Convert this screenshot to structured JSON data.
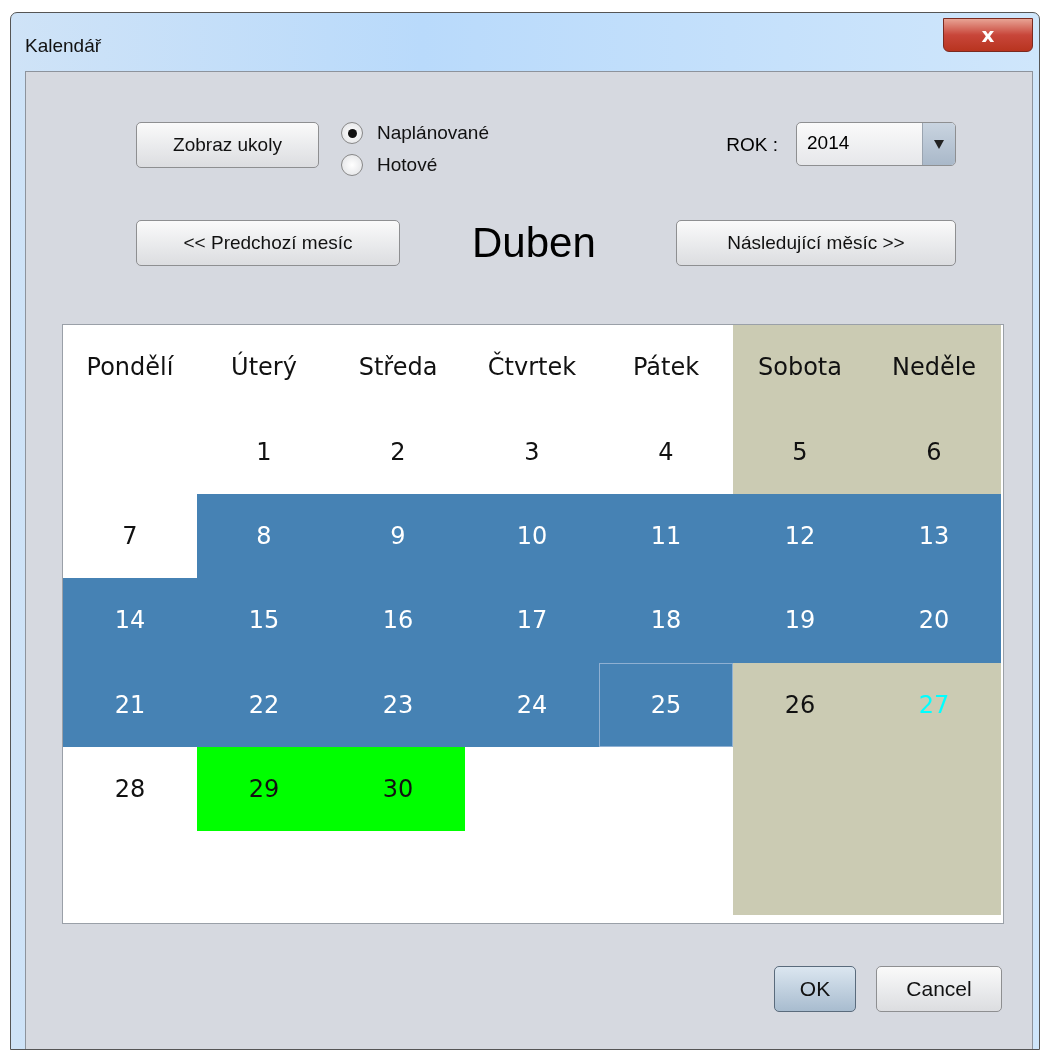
{
  "window": {
    "title": "Kalendář",
    "close": "x"
  },
  "show_tasks_button": "Zobraz ukoly",
  "filter": [
    {
      "label": "Naplánované",
      "selected": true
    },
    {
      "label": "Hotové",
      "selected": false
    }
  ],
  "year": {
    "label": "ROK :",
    "value": "2014"
  },
  "prev_button": "<< Predchozí mesíc",
  "month": "Duben",
  "next_button": "Následující měsíc >>",
  "calendar": {
    "headers": [
      {
        "label": "Pondělí",
        "color": "#ffffff"
      },
      {
        "label": "Úterý",
        "color": "#ffffff"
      },
      {
        "label": "Středa",
        "color": "#ffffff"
      },
      {
        "label": "Čtvrtek",
        "color": "#ffffff"
      },
      {
        "label": "Pátek",
        "color": "#ffffff"
      },
      {
        "label": "Sobota",
        "color": "#cbcbb3"
      },
      {
        "label": "Neděle",
        "color": "#cbcbb3"
      }
    ],
    "weeks": [
      [
        {
          "day": "1",
          "color": "#ffffff",
          "marked": false
        },
        {
          "day": "2",
          "color": "#ffffff",
          "marked": false
        },
        {
          "day": "3",
          "color": "#ffffff",
          "marked": false
        },
        {
          "day": "4",
          "color": "#ffffff",
          "marked": false
        },
        {
          "day": "5",
          "color": "#cbcbb3",
          "marked": false
        },
        {
          "day": "6",
          "color": "#cbcbb3",
          "marked": false
        }
      ],
      [
        {
          "day": "7",
          "color": "#ffffff",
          "marked": false
        },
        {
          "day": "8",
          "color": "#4682b4",
          "marked": false
        },
        {
          "day": "9",
          "color": "#4682b4",
          "marked": false
        },
        {
          "day": "10",
          "color": "#4682b4",
          "marked": false
        },
        {
          "day": "11",
          "color": "#4682b4",
          "marked": false
        },
        {
          "day": "12",
          "color": "#4682b4",
          "marked": false
        },
        {
          "day": "13",
          "color": "#4682b4",
          "marked": false
        }
      ],
      [
        {
          "day": "14",
          "color": "#4682b4",
          "marked": false
        },
        {
          "day": "15",
          "color": "#4682b4",
          "marked": false
        },
        {
          "day": "16",
          "color": "#4682b4",
          "marked": false
        },
        {
          "day": "17",
          "color": "#4682b4",
          "marked": false
        },
        {
          "day": "18",
          "color": "#4682b4",
          "marked": false
        },
        {
          "day": "19",
          "color": "#4682b4",
          "marked": false
        },
        {
          "day": "20",
          "color": "#4682b4",
          "marked": false
        }
      ],
      [
        {
          "day": "21",
          "color": "#4682b4",
          "marked": false
        },
        {
          "day": "22",
          "color": "#4682b4",
          "marked": false
        },
        {
          "day": "23",
          "color": "#4682b4",
          "marked": false
        },
        {
          "day": "24",
          "color": "#4682b4",
          "marked": false
        },
        {
          "day": "25",
          "color": "#4682b4",
          "marked": false,
          "selected": true
        },
        {
          "day": "26",
          "color": "#cbcbb3",
          "marked": false
        },
        {
          "day": "27",
          "color": "#cbcbb3",
          "marked": true
        }
      ],
      [
        {
          "day": "28",
          "color": "#ffffff",
          "marked": false
        },
        {
          "day": "29",
          "color": "#00ff00",
          "marked": false
        },
        {
          "day": "30",
          "color": "#00ff00",
          "marked": false
        }
      ]
    ]
  },
  "buttons": [
    {
      "label": "OK",
      "kind": "default"
    },
    {
      "label": "Cancel",
      "kind": "normal"
    }
  ]
}
